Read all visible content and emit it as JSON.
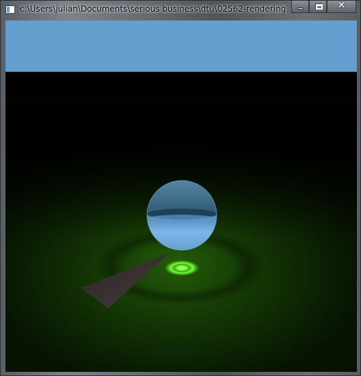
{
  "window": {
    "title": "c:\\Users\\julian\\Documents\\serious business\\dtu\\02562-rendering\\0256..."
  },
  "icons": {
    "app": "app-icon",
    "minimize": "minimize-icon",
    "maximize": "maximize-icon",
    "close": "close-icon"
  },
  "colors": {
    "sky": "#659fd0",
    "background": "#000000",
    "floor_glow": "#2f7a0c",
    "caustic": "#7cff3a",
    "sphere_top": "#3d6c8c",
    "sphere_bottom": "#78b4e6",
    "triangle": "#3a3332"
  },
  "caption": {
    "close_glyph": "✕"
  }
}
